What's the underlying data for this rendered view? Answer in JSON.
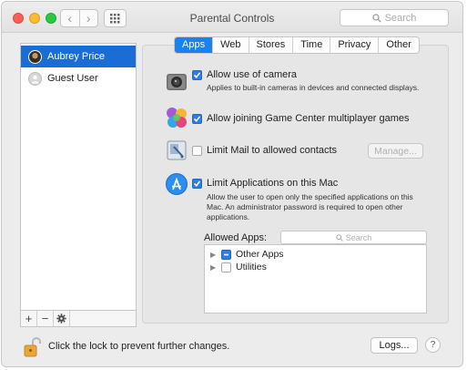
{
  "window": {
    "title": "Parental Controls"
  },
  "toolbar": {
    "back_icon": "chevron-left-icon",
    "forward_icon": "chevron-right-icon",
    "grid_icon": "show-all-grid-icon",
    "search_placeholder": "Search"
  },
  "sidebar": {
    "users": [
      {
        "name": "Aubrey Price",
        "selected": true,
        "avatar": "photo"
      },
      {
        "name": "Guest User",
        "selected": false,
        "avatar": "guest"
      }
    ],
    "tools": {
      "add": "+",
      "remove": "−",
      "settings_icon": "gear-icon"
    }
  },
  "tabs": [
    {
      "label": "Apps",
      "active": true
    },
    {
      "label": "Web",
      "active": false
    },
    {
      "label": "Stores",
      "active": false
    },
    {
      "label": "Time",
      "active": false
    },
    {
      "label": "Privacy",
      "active": false
    },
    {
      "label": "Other",
      "active": false
    }
  ],
  "apps": {
    "camera": {
      "label": "Allow use of camera",
      "checked": true,
      "description": "Applies to built-in cameras in devices and connected displays.",
      "icon": "camera-icon"
    },
    "game_center": {
      "label": "Allow joining Game Center multiplayer games",
      "checked": true,
      "icon": "game-center-icon"
    },
    "mail": {
      "label": "Limit Mail to allowed contacts",
      "checked": false,
      "manage_button": "Manage...",
      "icon": "mail-icon"
    },
    "limit_apps": {
      "label": "Limit Applications on this Mac",
      "checked": true,
      "description_lines": [
        "Allow the user to open only the specified applications on this",
        "Mac. An administrator password is required to open other",
        "applications."
      ],
      "icon": "app-store-icon"
    },
    "allowed_apps_label": "Allowed Apps:",
    "allowed_search_placeholder": "Search",
    "allowed_list": [
      {
        "label": "Other Apps",
        "state": "mixed"
      },
      {
        "label": "Utilities",
        "state": "off"
      }
    ]
  },
  "footer": {
    "lock_text": "Click the lock to prevent further changes.",
    "logs_button": "Logs...",
    "help_button": "?"
  },
  "colors": {
    "accent": "#1b80f0",
    "selection": "#1b6dd6",
    "checkbox_on": "#2f7de1"
  }
}
